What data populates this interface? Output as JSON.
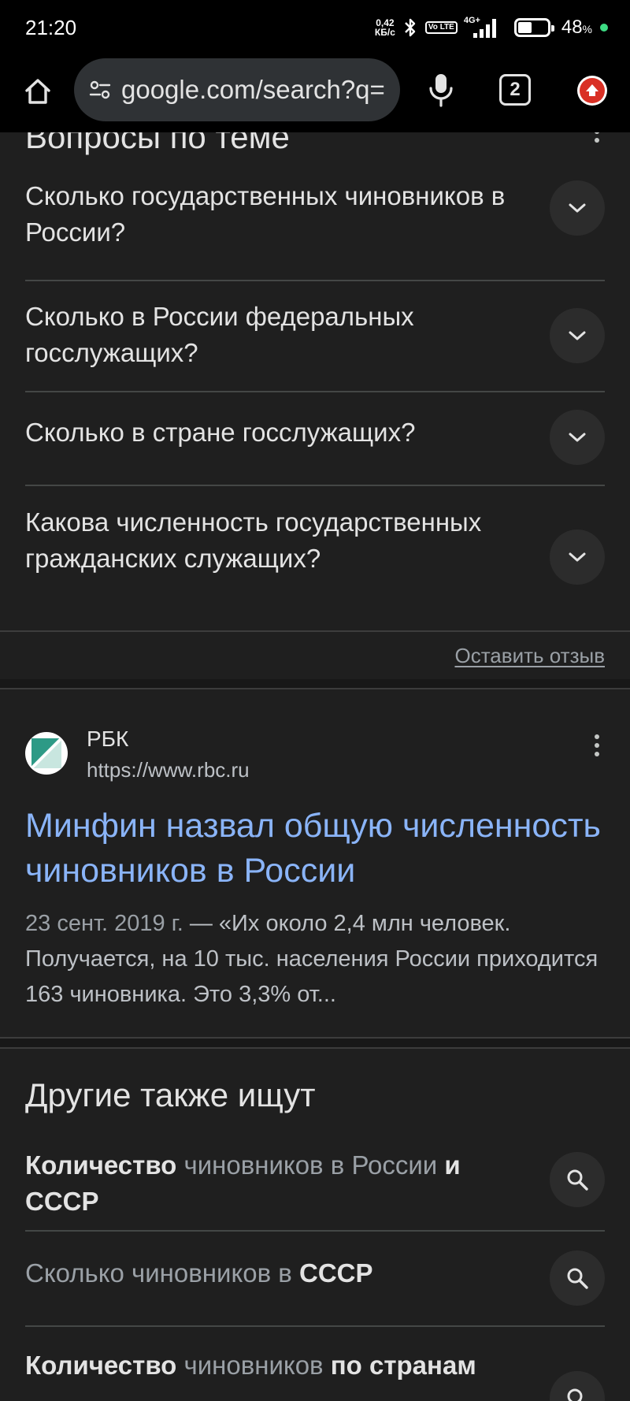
{
  "status_bar": {
    "time": "21:20",
    "net_speed_value": "0,42",
    "net_speed_unit": "КБ/с",
    "volte": "Vo LTE",
    "network": "4G+",
    "battery_percent": "48",
    "battery_percent_sign": "%",
    "battery_level": 0.48,
    "charging_dot_color": "#3ddc84",
    "icons": [
      "bluetooth-icon",
      "signal-icon",
      "battery-icon"
    ]
  },
  "toolbar": {
    "url": "google.com/search?q=",
    "tab_count": "2",
    "icons": [
      "home-icon",
      "site-settings-icon",
      "mic-icon",
      "tabs-icon",
      "update-icon"
    ]
  },
  "related_questions": {
    "title": "Вопросы по теме",
    "items": [
      {
        "question": "Сколько государственных чиновников в России?"
      },
      {
        "question": "Сколько в России федеральных госслужащих?"
      },
      {
        "question": "Сколько в стране госслужащих?"
      },
      {
        "question": "Какова численность государственных гражданских служащих?"
      }
    ],
    "feedback_link": "Оставить отзыв"
  },
  "result": {
    "site_name": "РБК",
    "site_url": "https://www.rbc.ru",
    "title": "Минфин назвал общую численность чиновников в России",
    "date": "23 сент. 2019 г.",
    "snippet": " — «Их около 2,4 млн человек. Получается, на 10 тыс. населения России приходится 163 чиновника. Это 3,3% от...",
    "title_color": "#8ab4f8"
  },
  "people_also_search": {
    "title": "Другие также ищут",
    "items": [
      {
        "parts": [
          {
            "text": "Количество",
            "bold": true
          },
          {
            "text": " чиновников в России ",
            "bold": false
          },
          {
            "text": "и СССР",
            "bold": true
          }
        ]
      },
      {
        "parts": [
          {
            "text": "Сколько ",
            "bold": false
          },
          {
            "text": "чиновников",
            "bold": false
          },
          {
            "text": " в ",
            "bold": false
          },
          {
            "text": "СССР",
            "bold": true
          }
        ]
      },
      {
        "parts": [
          {
            "text": "Количество",
            "bold": true
          },
          {
            "text": " чиновников ",
            "bold": false
          },
          {
            "text": "по странам",
            "bold": true
          }
        ]
      }
    ]
  },
  "colors": {
    "background": "#1f1f1f",
    "text_primary": "#e3e3e3",
    "text_secondary": "#9aa0a6",
    "link": "#8ab4f8",
    "divider": "#444746"
  }
}
